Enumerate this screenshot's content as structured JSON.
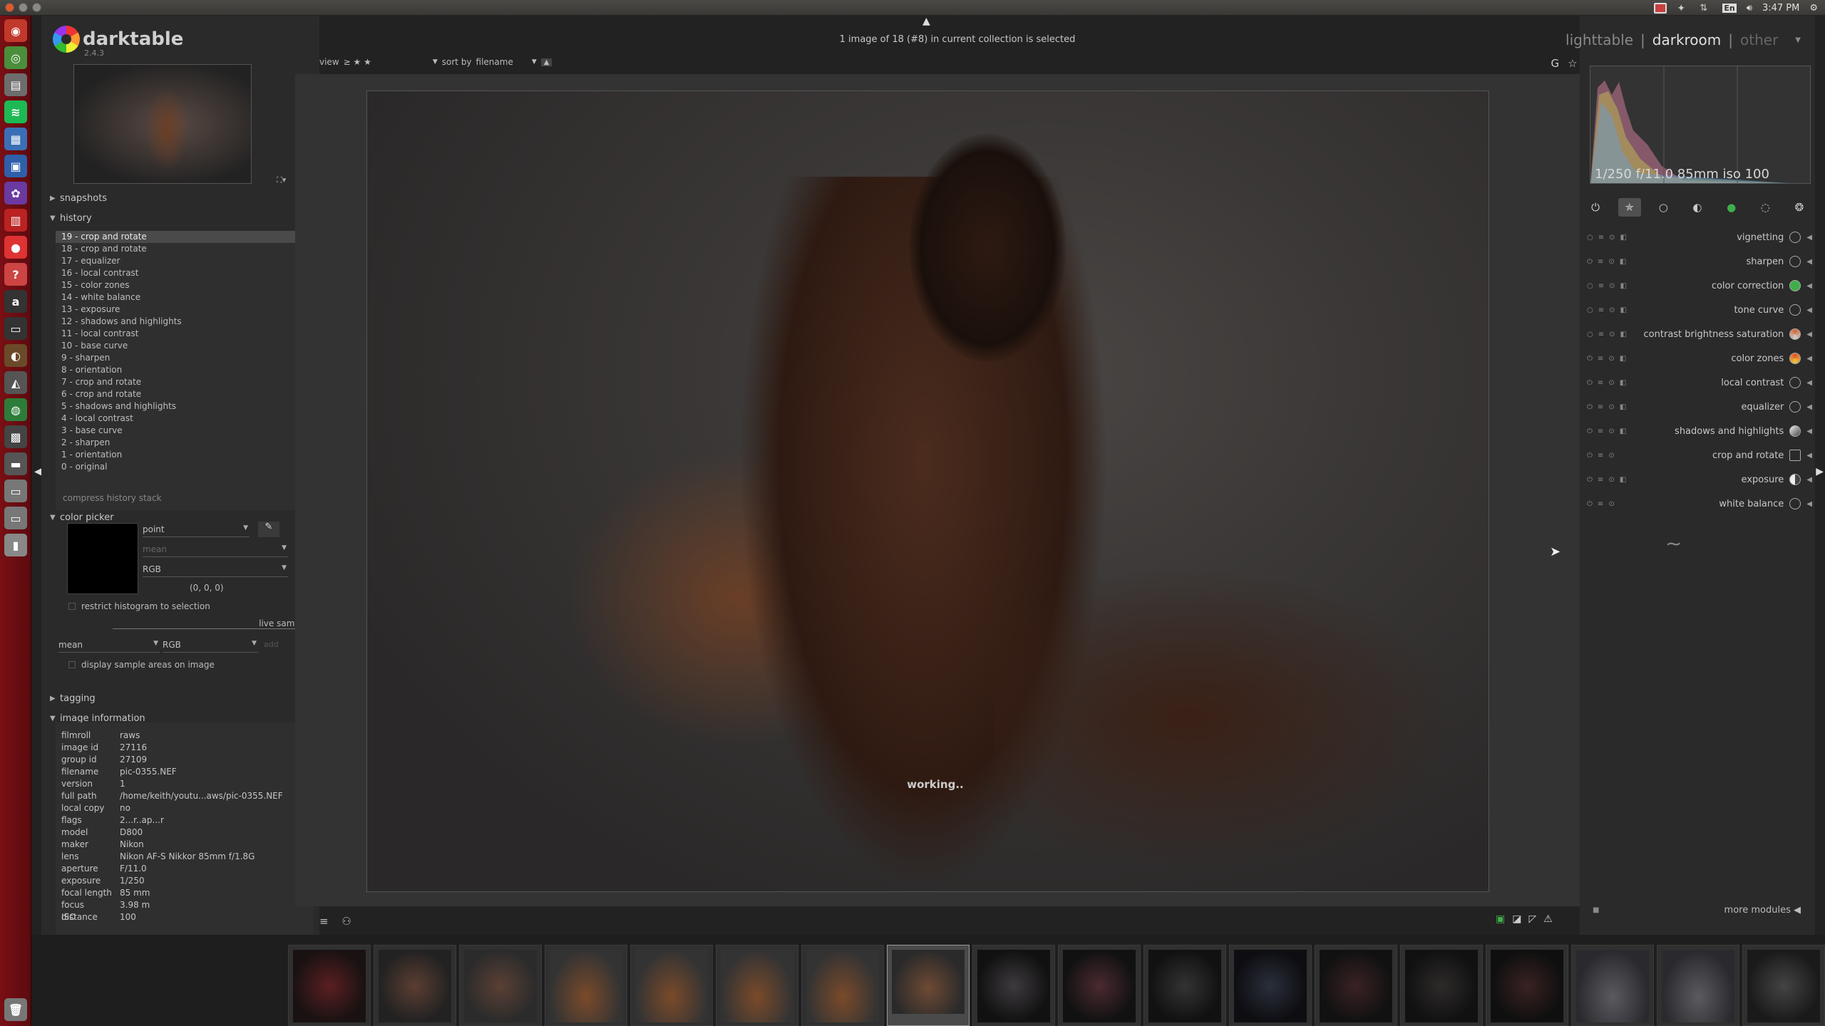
{
  "system": {
    "time": "3:47 PM",
    "keyboard": "En"
  },
  "app": {
    "name": "darktable",
    "version": "2.4.3"
  },
  "status_text": "1 image of 18 (#8) in current collection is selected",
  "viewbar": {
    "view_label": "view",
    "view_value": "≥ ★ ★",
    "sort_label": "sort by",
    "sort_value": "filename"
  },
  "top_icons": [
    "G",
    "☆",
    "⚙"
  ],
  "views": {
    "lighttable": "lighttable",
    "darkroom": "darkroom",
    "other": "other",
    "sep": "|"
  },
  "left": {
    "snapshots": "snapshots",
    "history_title": "history",
    "history": [
      "19 - crop and rotate",
      "18 - crop and rotate",
      "17 - equalizer",
      "16 - local contrast",
      "15 - color zones",
      "14 - white balance",
      "13 - exposure",
      "12 - shadows and highlights",
      "11 - local contrast",
      "10 - base curve",
      "9 - sharpen",
      "8 - orientation",
      "7 - crop and rotate",
      "6 - crop and rotate",
      "5 - shadows and highlights",
      "4 - local contrast",
      "3 - base curve",
      "2 - sharpen",
      "1 - orientation",
      "0 - original"
    ],
    "compress": "compress history stack",
    "color_picker": {
      "title": "color picker",
      "mode": "point",
      "stat": "mean",
      "model": "RGB",
      "value": "(0, 0, 0)",
      "restrict": "restrict histogram to selection",
      "live_samples": "live samples",
      "live_stat": "mean",
      "live_model": "RGB",
      "add": "add",
      "display_samples": "display sample areas on image"
    },
    "tagging": "tagging",
    "image_info_title": "image information",
    "image_info": [
      {
        "k": "filmroll",
        "v": "raws"
      },
      {
        "k": "image id",
        "v": "27116"
      },
      {
        "k": "group id",
        "v": "27109"
      },
      {
        "k": "filename",
        "v": "pic-0355.NEF"
      },
      {
        "k": "version",
        "v": "1"
      },
      {
        "k": "full path",
        "v": "/home/keith/youtu...aws/pic-0355.NEF"
      },
      {
        "k": "local copy",
        "v": "no"
      },
      {
        "k": "flags",
        "v": "2...r..ap...r"
      },
      {
        "k": "model",
        "v": "D800"
      },
      {
        "k": "maker",
        "v": "Nikon"
      },
      {
        "k": "lens",
        "v": "Nikon AF-S Nikkor 85mm f/1.8G"
      },
      {
        "k": "aperture",
        "v": "F/11.0"
      },
      {
        "k": "exposure",
        "v": "1/250"
      },
      {
        "k": "focal length",
        "v": "85 mm"
      },
      {
        "k": "focus distance",
        "v": "3.98 m"
      },
      {
        "k": "ISO",
        "v": "100"
      }
    ]
  },
  "center": {
    "working": "working.."
  },
  "right": {
    "exif": "1/250 f/11.0 85mm iso 100",
    "modules": [
      {
        "name": "vignetting",
        "color": "#aaaaaa"
      },
      {
        "name": "sharpen",
        "color": "#888888"
      },
      {
        "name": "color correction",
        "color": "#3fae4a"
      },
      {
        "name": "tone curve",
        "color": "#888888"
      },
      {
        "name": "contrast brightness saturation",
        "color": "#d06a3a"
      },
      {
        "name": "color zones",
        "color": "#e0562a"
      },
      {
        "name": "local contrast",
        "color": "#888888"
      },
      {
        "name": "equalizer",
        "color": "#888888"
      },
      {
        "name": "shadows and highlights",
        "color": "#aaaaaa"
      },
      {
        "name": "crop and rotate",
        "color": "#888888"
      },
      {
        "name": "exposure",
        "color": "#aaaaaa"
      },
      {
        "name": "white balance",
        "color": "#888888"
      }
    ],
    "more_modules": "more modules"
  },
  "colors": {
    "accent": "#e0e0e0",
    "panel": "#2a2a2a",
    "launcher": "#7a0f14"
  }
}
